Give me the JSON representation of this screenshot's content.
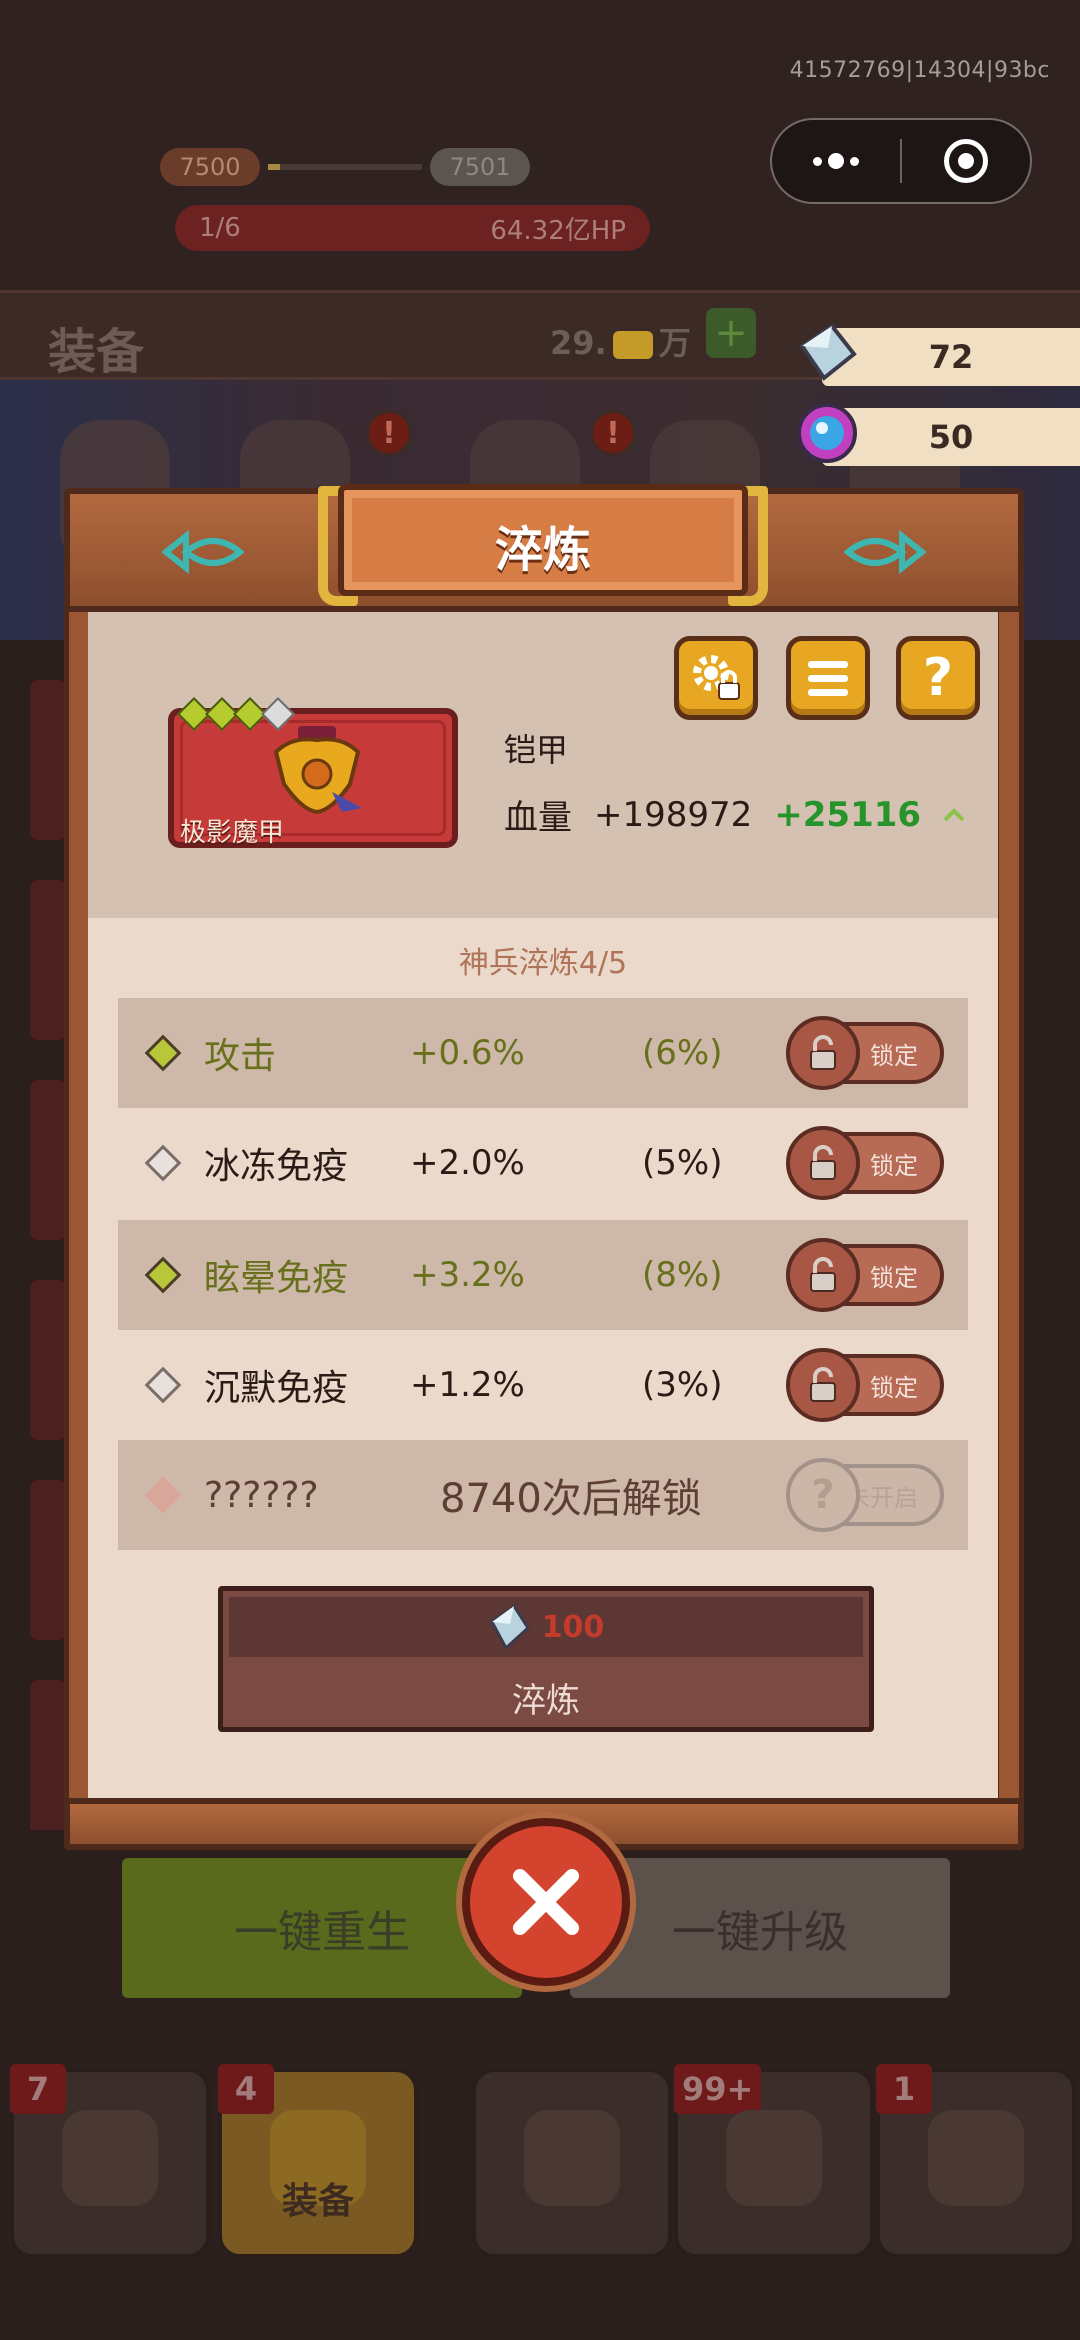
{
  "status": {
    "user_id": "41572769|14304|93bc"
  },
  "background": {
    "level_current": "7500",
    "level_next": "7501",
    "level_progress": 0.08,
    "hp_stage": "1/6",
    "hp_value": "64.32亿HP",
    "section_title": "装备",
    "coins_prefix": "29.",
    "coins_suffix": "万",
    "plus_label": "+",
    "alert_label": "!",
    "rebirth_label": "一键重生",
    "upgrade_label": "一键升级"
  },
  "currencies": [
    {
      "name": "crystal",
      "icon": "crystal-icon",
      "amount": "72"
    },
    {
      "name": "orb",
      "icon": "orb-icon",
      "amount": "50"
    }
  ],
  "tabbar": [
    {
      "badge": "7",
      "label": "",
      "icon": "hero-icon"
    },
    {
      "badge": "4",
      "label": "装备",
      "icon": "armor-icon"
    },
    {
      "badge": "",
      "label": "",
      "icon": "skill-icon"
    },
    {
      "badge": "99+",
      "label": "",
      "icon": "chest-icon"
    },
    {
      "badge": "1",
      "label": "",
      "icon": "scroll-icon"
    }
  ],
  "modal": {
    "title": "淬炼",
    "item": {
      "name": "极影魔甲",
      "type": "铠甲",
      "stat_label": "血量",
      "stat_value": "+198972",
      "stat_bonus": "+25116",
      "stars_green": 3,
      "stars_total": 4
    },
    "refine_level": "神兵淬炼4/5",
    "attributes": [
      {
        "name": "攻击",
        "value": "+0.6%",
        "max": "(6%)",
        "quality": "green",
        "lock_label": "锁定"
      },
      {
        "name": "冰冻免疫",
        "value": "+2.0%",
        "max": "(5%)",
        "quality": "white",
        "lock_label": "锁定"
      },
      {
        "name": "眩晕免疫",
        "value": "+3.2%",
        "max": "(8%)",
        "quality": "green",
        "lock_label": "锁定"
      },
      {
        "name": "沉默免疫",
        "value": "+1.2%",
        "max": "(3%)",
        "quality": "white",
        "lock_label": "锁定"
      }
    ],
    "locked_slot": {
      "name": "??????",
      "unlock_note": "8740次后解锁",
      "button_label": "未开启",
      "button_icon": "?"
    },
    "refine_button": {
      "cost": "100",
      "label": "淬炼"
    },
    "help_label": "?"
  },
  "colors": {
    "accent_gold": "#e7a723",
    "bonus_green": "#26932b",
    "close_red": "#d3432d",
    "cost_red": "#c23b2c"
  }
}
